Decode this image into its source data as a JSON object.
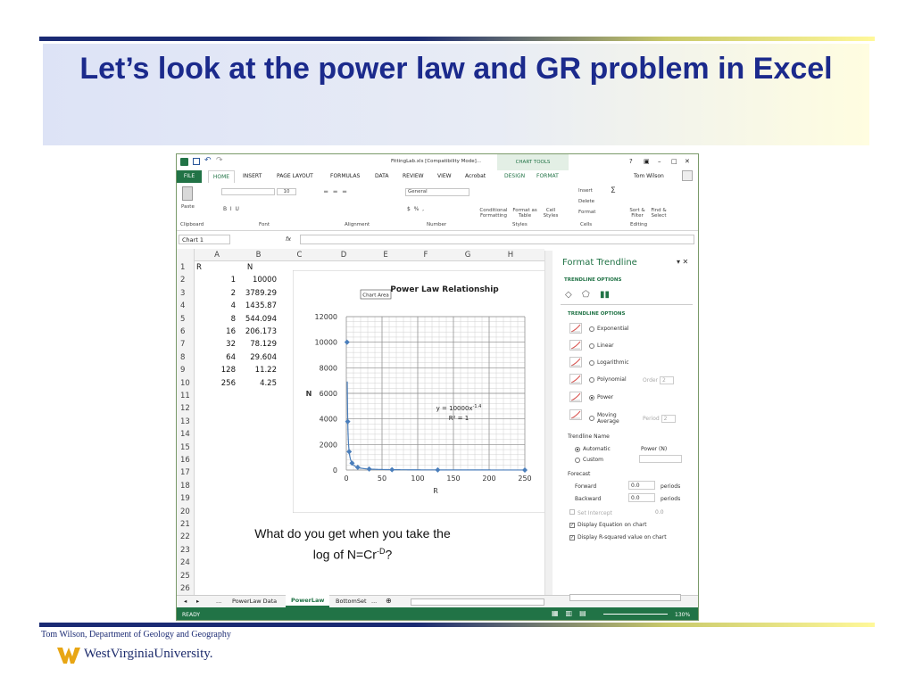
{
  "slide": {
    "title": "Let’s look at the power law and GR problem in Excel",
    "question_line1": "What do you get when you take the",
    "question_line2a": "log of N=Cr",
    "question_sup": "-D",
    "question_line2b": "?",
    "footer": "Tom Wilson, Department of Geology and Geography",
    "logo": "WestVirginiaUniversity."
  },
  "excel": {
    "title_file": "FittingLab.xls  [Compatibility Mode]...",
    "chart_tools": "CHART TOOLS",
    "window_controls": [
      "?",
      "▣",
      "–",
      "□",
      "✕"
    ],
    "tabs": [
      "FILE",
      "HOME",
      "INSERT",
      "PAGE LAYOUT",
      "FORMULAS",
      "DATA",
      "REVIEW",
      "VIEW",
      "Acrobat",
      "DESIGN",
      "FORMAT"
    ],
    "user": "Tom Wilson",
    "ribbon": {
      "paste": "Paste",
      "font_size": "10",
      "number_format": "General",
      "groups": [
        "Clipboard",
        "Font",
        "Alignment",
        "Number",
        "Styles",
        "Cells",
        "Editing"
      ],
      "cond": "Conditional Formatting",
      "fmt_table": "Format as Table",
      "cell_styles": "Cell Styles",
      "insert": "Insert",
      "delete": "Delete",
      "format": "Format",
      "sort": "Sort & Filter",
      "find": "Find & Select"
    },
    "name_box": "Chart 1",
    "fx": "fx",
    "columns": [
      "A",
      "B",
      "C",
      "D",
      "E",
      "F",
      "G",
      "H"
    ],
    "rows": [
      "1",
      "2",
      "3",
      "4",
      "5",
      "6",
      "7",
      "8",
      "9",
      "10",
      "11",
      "12",
      "13",
      "14",
      "15",
      "16",
      "17",
      "18",
      "19",
      "20",
      "21",
      "22",
      "23",
      "24",
      "25",
      "26"
    ],
    "header_a": "R",
    "header_b": "N",
    "data_r": [
      "1",
      "2",
      "4",
      "8",
      "16",
      "32",
      "64",
      "128",
      "256"
    ],
    "data_n": [
      "10000",
      "3789.29",
      "1435.87",
      "544.094",
      "206.173",
      "78.129",
      "29.604",
      "11.22",
      "4.25"
    ],
    "sheet_tabs": [
      "...",
      "PowerLaw Data",
      "PowerLaw",
      "BottomSet",
      "..."
    ],
    "status_ready": "READY",
    "zoom": "130%"
  },
  "chart_data": {
    "type": "scatter",
    "title": "Power Law Relationship",
    "chart_area_tag": "Chart Area",
    "xlabel": "R",
    "ylabel": "N",
    "xlim": [
      0,
      250
    ],
    "ylim": [
      0,
      12000
    ],
    "x_ticks": [
      0,
      50,
      100,
      150,
      200,
      250
    ],
    "y_ticks": [
      0,
      2000,
      4000,
      6000,
      8000,
      10000,
      12000
    ],
    "x": [
      1,
      2,
      4,
      8,
      16,
      32,
      64,
      128,
      256
    ],
    "y": [
      10000,
      3789.29,
      1435.87,
      544.094,
      206.173,
      78.129,
      29.604,
      11.22,
      4.25
    ],
    "trendline": "power",
    "equation_base": "y = 10000x",
    "equation_exp": "-1.4",
    "r2": "R² = 1",
    "marker_color": "#4a7ebb"
  },
  "panel": {
    "title": "Format Trendline",
    "section": "TRENDLINE OPTIONS",
    "subsection": "TRENDLINE OPTIONS",
    "options": [
      "Exponential",
      "Linear",
      "Logarithmic",
      "Polynomial",
      "Power",
      "Moving Average"
    ],
    "order_label": "Order",
    "order_val": "2",
    "period_label": "Period",
    "period_val": "2",
    "name_label": "Trendline Name",
    "automatic": "Automatic",
    "automatic_val": "Power (N)",
    "custom": "Custom",
    "forecast": "Forecast",
    "forward": "Forward",
    "forward_val": "0.0",
    "backward": "Backward",
    "backward_val": "0.0",
    "periods": "periods",
    "intercept": "Set Intercept",
    "intercept_val": "0.0",
    "disp_eq": "Display Equation on chart",
    "disp_r2": "Display R-squared value on chart"
  }
}
